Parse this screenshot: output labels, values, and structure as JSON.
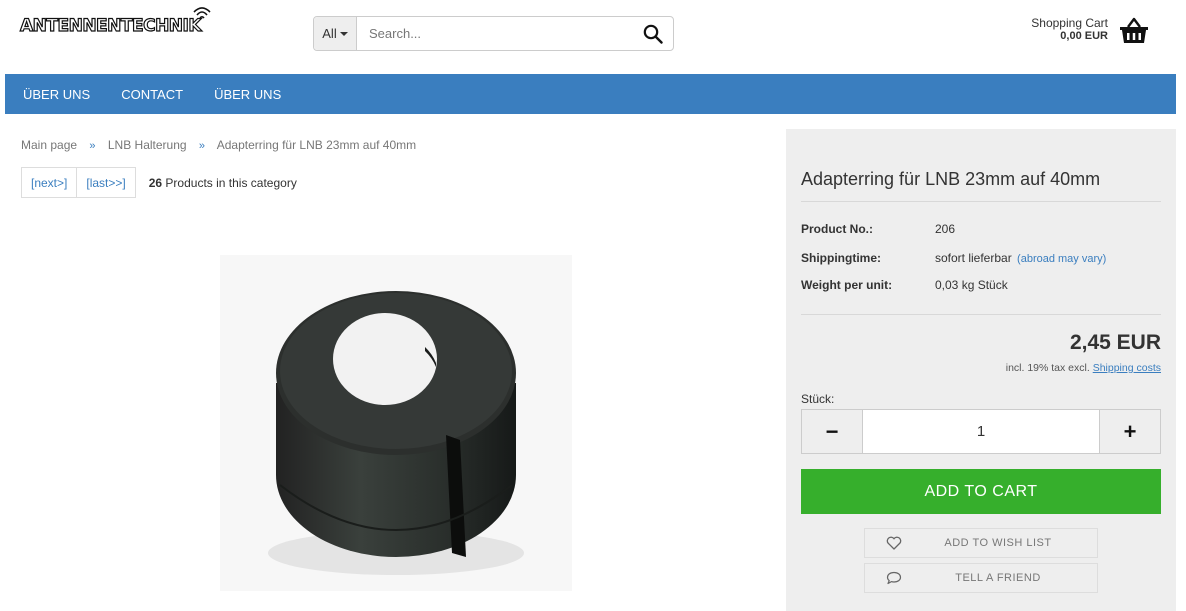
{
  "header": {
    "logo_text": "ANTENNENTECHNIK",
    "search": {
      "category": "All",
      "placeholder": "Search..."
    },
    "cart": {
      "label": "Shopping Cart",
      "total": "0,00 EUR"
    }
  },
  "nav": {
    "items": [
      {
        "label": "ÜBER UNS"
      },
      {
        "label": "CONTACT"
      },
      {
        "label": "ÜBER UNS"
      }
    ]
  },
  "breadcrumb": [
    "Main page",
    "LNB Halterung",
    "Adapterring für LNB 23mm auf 40mm"
  ],
  "breadcrumb_separator": "»",
  "pagination": {
    "next": "[next>]",
    "last": "[last>>]",
    "count": "26",
    "count_text": "Products in this category"
  },
  "product": {
    "title": "Adapterring für LNB 23mm auf 40mm",
    "details": [
      {
        "key": "Product No.:",
        "value": "206",
        "note": ""
      },
      {
        "key": "Shippingtime:",
        "value": "sofort lieferbar",
        "note": "(abroad may vary)"
      },
      {
        "key": "Weight per unit:",
        "value": "0,03 kg Stück",
        "note": ""
      }
    ],
    "price": "2,45 EUR",
    "tax_text": "incl. 19% tax excl.",
    "shipping_link": "Shipping costs",
    "quantity_label": "Stück:",
    "quantity": "1",
    "minus_label": "−",
    "plus_label": "+",
    "add_to_cart": "ADD TO CART",
    "wishlist": "ADD TO WISH LIST",
    "tell_friend": "TELL A FRIEND"
  },
  "colors": {
    "nav": "#3a7ebf",
    "add_to_cart": "#36af2c",
    "panel": "#eeeeee",
    "link": "#3a7ebf"
  },
  "icons": {
    "search": "magnifier-icon",
    "cart": "basket-icon",
    "wishlist": "heart-icon",
    "tell": "speech-bubble-icon",
    "logo": "signal-waves-icon"
  }
}
